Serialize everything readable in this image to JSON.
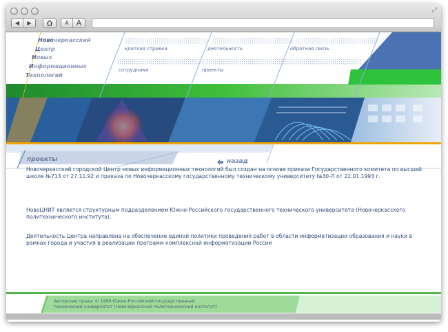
{
  "wordmark": {
    "lines": [
      {
        "first": "Ново",
        "rest": "черкасский"
      },
      {
        "first": "Ц",
        "rest": "ентр"
      },
      {
        "first": "Н",
        "rest": "овых"
      },
      {
        "first": "И",
        "rest": "нформационных"
      },
      {
        "first": "Т",
        "rest": "ехнологий"
      }
    ]
  },
  "menu": {
    "brief": "краткая справка",
    "activity": "деятельность",
    "feedback": "обратная связь",
    "staff": "сотрудники",
    "projects": "проекты"
  },
  "page": {
    "title": "проекты",
    "back": "назад"
  },
  "body": {
    "p1": "Новочеркасский городской Центр новых информационных технологий был создан на основе приказа Государственного комитета по высшей школе №713 от 27.11.92 и приказа по Новочеркасскому государственному техническому университету №30-Л от 22.01.1993 г.",
    "p2": "НовоЦНИТ является структурным подразделением Южно-Российского государственного технического университета (Новочеркасского политехнического института).",
    "p3": "Деятельность Центра направлена на обеспечение единой политики проведения работ в области информатизации образования и науки в рамках города и участия в реализации программ комплексной информатизации России"
  },
  "footer": {
    "line1": "Авторские права: © 1999 Южно-Российский государственный",
    "line2": "технический университет (Новочеркасский политехнический институт)"
  },
  "icons": {
    "back": "arrow-back-icon",
    "forward": "arrow-forward-icon",
    "home": "home-icon",
    "font-decrease": "font-decrease-icon",
    "font-increase": "font-increase-icon"
  }
}
